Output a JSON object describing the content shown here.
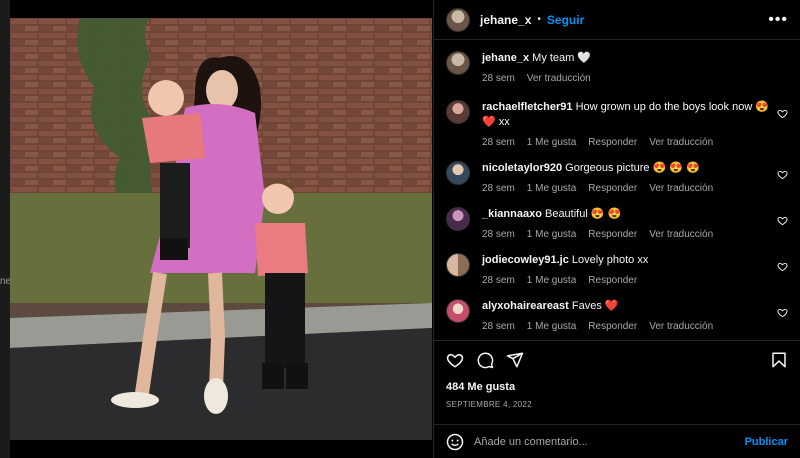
{
  "side_stub": "ne",
  "post": {
    "author": "jehane_x",
    "follow_label": "Seguir",
    "more_label": "•••",
    "caption": {
      "username": "jehane_x",
      "text": "My team 🤍",
      "time": "28 sem",
      "translate": "Ver traducción"
    },
    "comments": [
      {
        "username": "rachaelfletcher91",
        "text": "How grown up do the boys look now 😍 ❤️ xx",
        "time": "28 sem",
        "likes": "1 Me gusta",
        "reply": "Responder",
        "translate": "Ver traducción"
      },
      {
        "username": "nicoletaylor920",
        "text": "Gorgeous picture 😍 😍 😍",
        "time": "28 sem",
        "likes": "1 Me gusta",
        "reply": "Responder",
        "translate": "Ver traducción"
      },
      {
        "username": "_kiannaaxo",
        "text": "Beautiful 😍 😍",
        "time": "28 sem",
        "likes": "1 Me gusta",
        "reply": "Responder",
        "translate": "Ver traducción"
      },
      {
        "username": "jodiecowley91.jc",
        "text": "Lovely photo xx",
        "time": "28 sem",
        "likes": "1 Me gusta",
        "reply": "Responder"
      },
      {
        "username": "alyxohaireareast",
        "text": "Faves ❤️",
        "time": "28 sem",
        "likes": "1 Me gusta",
        "reply": "Responder",
        "translate": "Ver traducción"
      }
    ],
    "like_count": "484 Me gusta",
    "date": "SEPTIEMBRE 4, 2022",
    "add_comment_placeholder": "Añade un comentario...",
    "publish_label": "Publicar"
  },
  "colors": {
    "accent": "#0095f6",
    "muted": "#a8a8a8",
    "background": "#000000"
  },
  "icons": [
    "heart-icon",
    "comment-icon",
    "share-icon",
    "bookmark-icon",
    "emoji-icon",
    "more-icon"
  ]
}
